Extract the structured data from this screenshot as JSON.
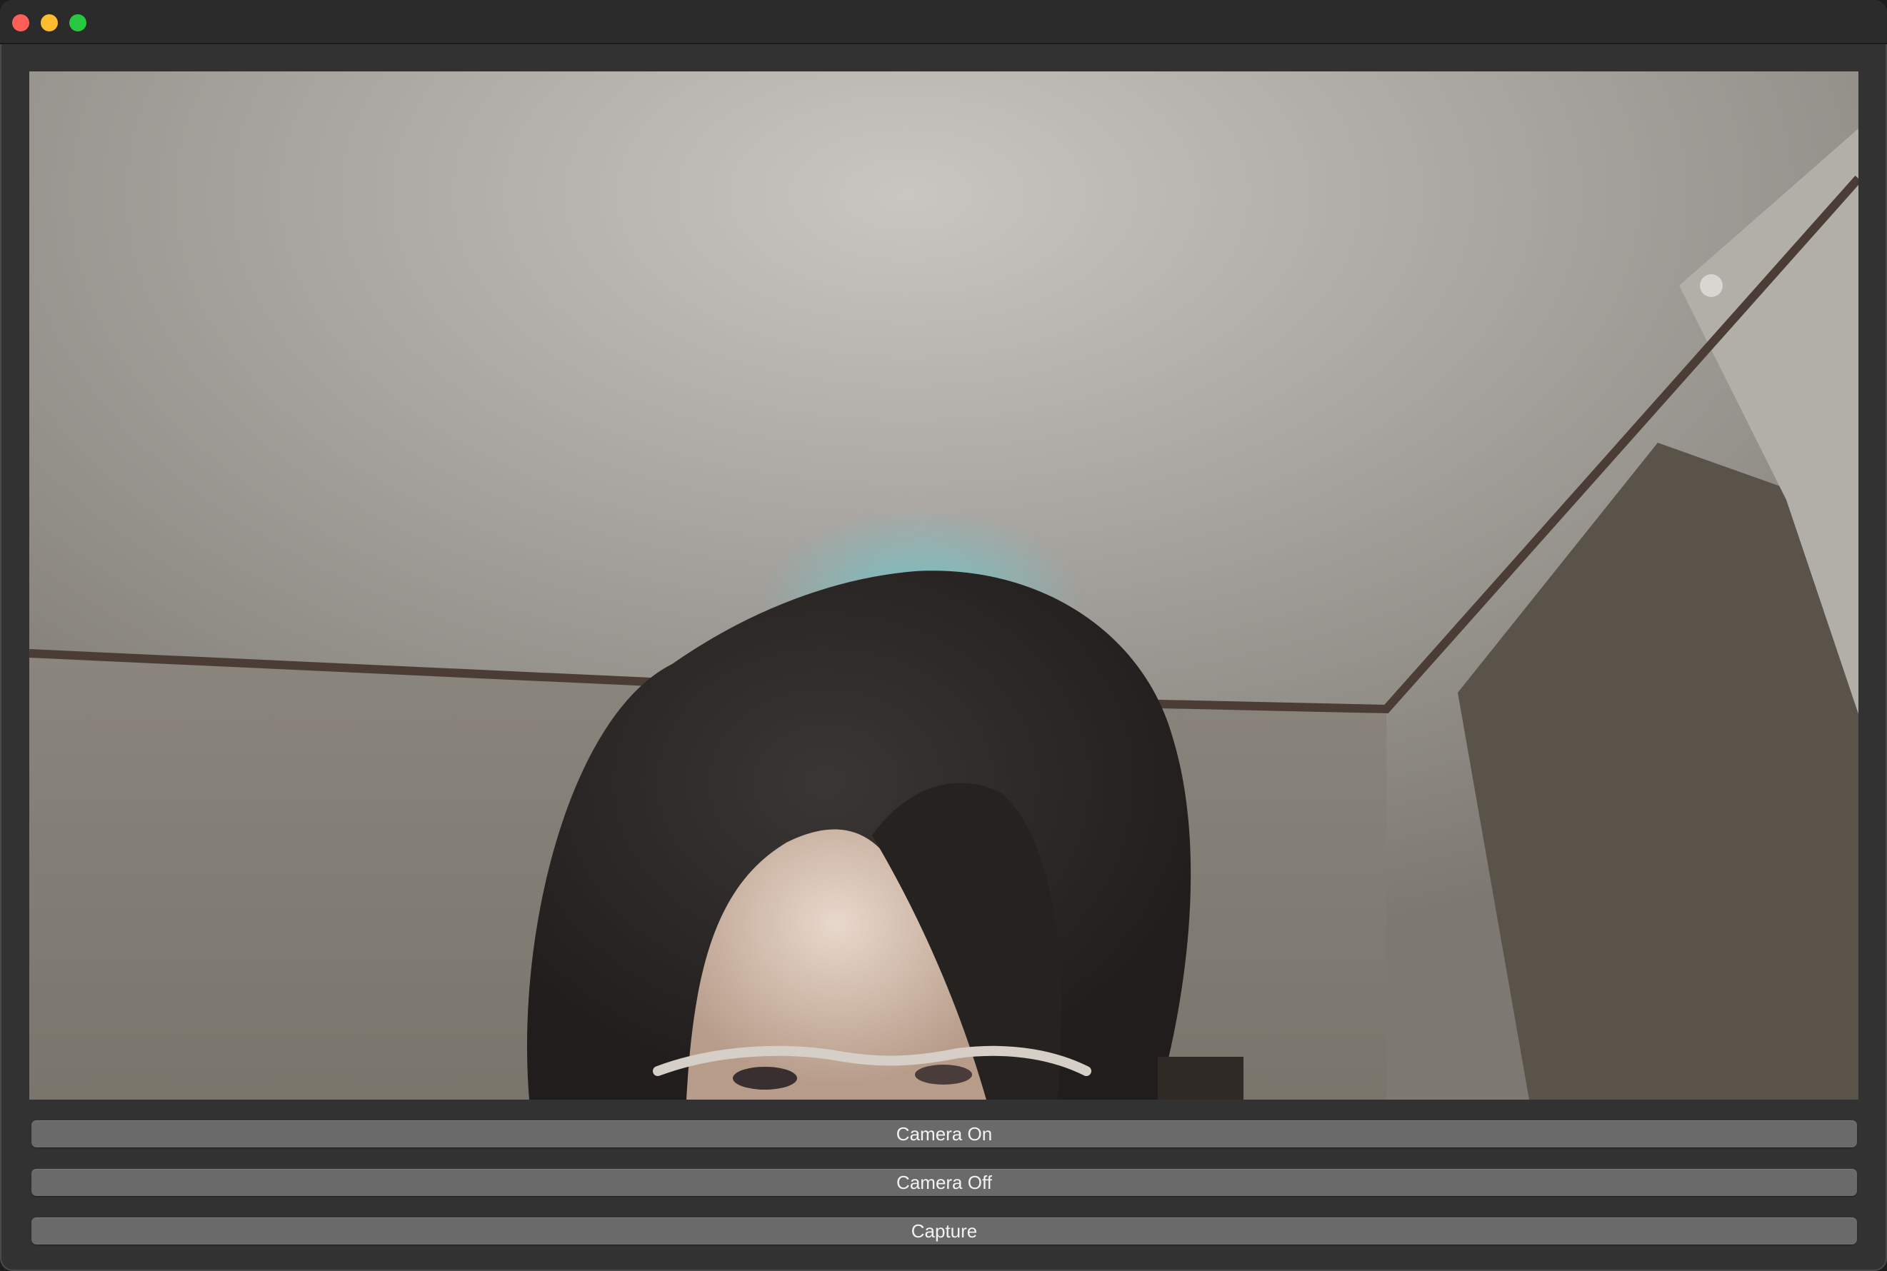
{
  "window": {
    "controls": [
      "close",
      "minimize",
      "zoom"
    ]
  },
  "camera": {
    "feed_icon": "camera-feed"
  },
  "buttons": {
    "camera_on": "Camera On",
    "camera_off": "Camera Off",
    "capture": "Capture"
  },
  "colors": {
    "window_bg": "#323232",
    "button_bg": "#6a6a6a",
    "close": "#fe5f57",
    "minimize": "#febc2e",
    "zoom": "#28c840"
  }
}
